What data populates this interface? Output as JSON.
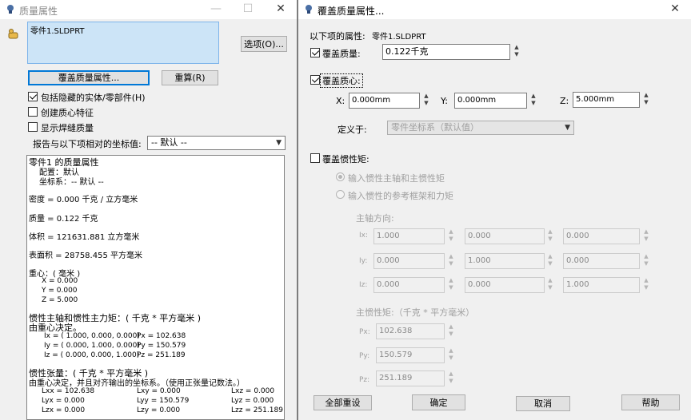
{
  "left_window": {
    "title": "质量属性",
    "minimize": "—",
    "maximize": "☐",
    "close": "✕",
    "selected_part": "零件1.SLDPRT",
    "options_button": "选项(O)...",
    "override_button": "覆盖质量属性...",
    "recalc_button": "重算(R)",
    "include_hidden_label": "包括隐藏的实体/零部件(H)",
    "include_hidden_checked": true,
    "create_com_label": "创建质心特征",
    "create_com_checked": false,
    "show_weld_label": "显示焊缝质量",
    "show_weld_checked": false,
    "coord_label": "报告与以下项相对的坐标值:",
    "coord_value": "-- 默认 --",
    "report": {
      "header": "零件1 的质量属性",
      "config": "配置：默认",
      "coord_sys": "坐标系：-- 默认 --",
      "density": "密度 = 0.000 千克 / 立方毫米",
      "mass": "质量 = 0.122 千克",
      "volume": "体积 = 121631.881 立方毫米",
      "surface_area": "表面积 = 28758.455  平方毫米",
      "com_title": "重心：( 毫米 )",
      "com_x": "X = 0.000",
      "com_y": "Y = 0.000",
      "com_z": "Z = 5.000",
      "principal_title": "惯性主轴和惯性主力矩：( 千克 * 平方毫米 )",
      "principal_sub": "由重心决定。",
      "ix": "Ix = ( 1.000,  0.000,  0.000)",
      "iy": "Iy = ( 0.000,  1.000,  0.000)",
      "iz": "Iz = ( 0.000,  0.000,  1.000)",
      "px": "Px = 102.638",
      "py": "Py = 150.579",
      "pz": "Pz = 251.189",
      "tensor_title": "惯性张量：( 千克 * 平方毫米 )",
      "tensor_sub": "由重心决定，并且对齐输出的坐标系。（使用正张量记数法。）",
      "lxx": "Lxx = 102.638",
      "lxy": "Lxy = 0.000",
      "lxz": "Lxz = 0.000",
      "lyx": "Lyx = 0.000",
      "lyy": "Lyy = 150.579",
      "lyz": "Lyz = 0.000",
      "lzx": "Lzx = 0.000",
      "lzy": "Lzy = 0.000",
      "lzz": "Lzz = 251.189"
    }
  },
  "right_window": {
    "title": "覆盖质量属性...",
    "close": "✕",
    "props_for_label": "以下项的属性:",
    "props_for_value": "零件1.SLDPRT",
    "override_mass_label": "覆盖质量:",
    "override_mass_checked": true,
    "mass_value": "0.122千克",
    "override_com_label": "覆盖质心:",
    "override_com_checked": true,
    "x_label": "X:",
    "x_value": "0.000mm",
    "y_label": "Y:",
    "y_value": "0.000mm",
    "z_label": "Z:",
    "z_value": "5.000mm",
    "defined_by_label": "定义于:",
    "defined_by_value": "零件坐标系（默认值）",
    "override_moments_label": "覆盖惯性矩:",
    "override_moments_checked": false,
    "radio_principal": "输入惯性主轴和主惯性矩",
    "radio_reference": "输入惯性的参考框架和力矩",
    "axes_title": "主轴方向:",
    "ix_label": "Ix:",
    "iy_label": "Iy:",
    "iz_label": "Iz:",
    "ix_values": [
      "1.000",
      "0.000",
      "0.000"
    ],
    "iy_values": [
      "0.000",
      "1.000",
      "0.000"
    ],
    "iz_values": [
      "0.000",
      "0.000",
      "1.000"
    ],
    "moments_title": "主惯性矩:（千克 * 平方毫米）",
    "px_label": "Px:",
    "py_label": "Py:",
    "pz_label": "Pz:",
    "px_value": "102.638",
    "py_value": "150.579",
    "pz_value": "251.189",
    "reset_all": "全部重设",
    "ok": "确定",
    "cancel": "取消",
    "help": "帮助"
  }
}
